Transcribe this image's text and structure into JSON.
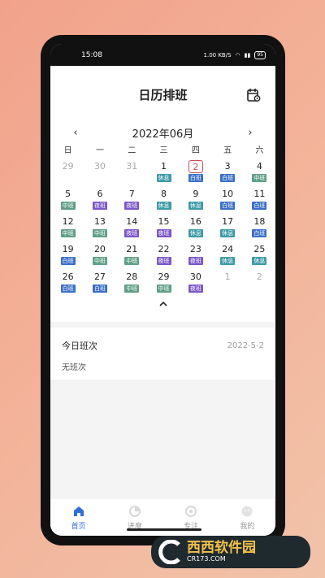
{
  "statusbar": {
    "time": "15:08",
    "speed": "1.00 KB/S",
    "battery": "95"
  },
  "header": {
    "title": "日历排班"
  },
  "calendar": {
    "month": "2022年06月",
    "prev": "‹",
    "next": "›",
    "weekdays": [
      "日",
      "一",
      "二",
      "三",
      "四",
      "五",
      "六"
    ],
    "days": [
      {
        "d": "29",
        "other": true,
        "tag": ""
      },
      {
        "d": "30",
        "other": true,
        "tag": ""
      },
      {
        "d": "31",
        "other": true,
        "tag": ""
      },
      {
        "d": "1",
        "tag": "休息",
        "color": "#3f9aa8"
      },
      {
        "d": "2",
        "today": true,
        "tag": "白班",
        "color": "#3a6fc7"
      },
      {
        "d": "3",
        "tag": "白班",
        "color": "#3a6fc7"
      },
      {
        "d": "4",
        "tag": "中班",
        "color": "#5f9f86"
      },
      {
        "d": "5",
        "tag": "中班",
        "color": "#5f9f86"
      },
      {
        "d": "6",
        "tag": "夜班",
        "color": "#7a57c7"
      },
      {
        "d": "7",
        "tag": "夜班",
        "color": "#7a57c7"
      },
      {
        "d": "8",
        "tag": "休息",
        "color": "#3f9aa8"
      },
      {
        "d": "9",
        "tag": "休息",
        "color": "#3f9aa8"
      },
      {
        "d": "10",
        "tag": "白班",
        "color": "#3a6fc7"
      },
      {
        "d": "11",
        "tag": "白班",
        "color": "#3a6fc7"
      },
      {
        "d": "12",
        "tag": "中班",
        "color": "#5f9f86"
      },
      {
        "d": "13",
        "tag": "中班",
        "color": "#5f9f86"
      },
      {
        "d": "14",
        "tag": "夜班",
        "color": "#7a57c7"
      },
      {
        "d": "15",
        "tag": "夜班",
        "color": "#7a57c7"
      },
      {
        "d": "16",
        "tag": "休息",
        "color": "#3f9aa8"
      },
      {
        "d": "17",
        "tag": "休息",
        "color": "#3f9aa8"
      },
      {
        "d": "18",
        "tag": "白班",
        "color": "#3a6fc7"
      },
      {
        "d": "19",
        "tag": "白班",
        "color": "#3a6fc7"
      },
      {
        "d": "20",
        "tag": "中班",
        "color": "#5f9f86"
      },
      {
        "d": "21",
        "tag": "中班",
        "color": "#5f9f86"
      },
      {
        "d": "22",
        "tag": "夜班",
        "color": "#7a57c7"
      },
      {
        "d": "23",
        "tag": "夜班",
        "color": "#7a57c7"
      },
      {
        "d": "24",
        "tag": "休息",
        "color": "#3f9aa8"
      },
      {
        "d": "25",
        "tag": "休息",
        "color": "#3f9aa8"
      },
      {
        "d": "26",
        "tag": "白班",
        "color": "#3a6fc7"
      },
      {
        "d": "27",
        "tag": "白班",
        "color": "#3a6fc7"
      },
      {
        "d": "28",
        "tag": "中班",
        "color": "#5f9f86"
      },
      {
        "d": "29",
        "tag": "中班",
        "color": "#5f9f86"
      },
      {
        "d": "30",
        "tag": "夜班",
        "color": "#7a57c7"
      },
      {
        "d": "1",
        "other": true,
        "tag": ""
      },
      {
        "d": "2",
        "other": true,
        "tag": ""
      }
    ],
    "collapse": "^"
  },
  "today_card": {
    "title": "今日班次",
    "date": "2022-5-2",
    "empty": "无班次"
  },
  "tabs": [
    {
      "label": "首页",
      "icon": "home-icon",
      "active": true
    },
    {
      "label": "进度",
      "icon": "progress-icon"
    },
    {
      "label": "专注",
      "icon": "focus-icon"
    },
    {
      "label": "我的",
      "icon": "profile-icon"
    }
  ],
  "watermark": {
    "brand": "西西软件园",
    "sub": "CR173.COM"
  }
}
